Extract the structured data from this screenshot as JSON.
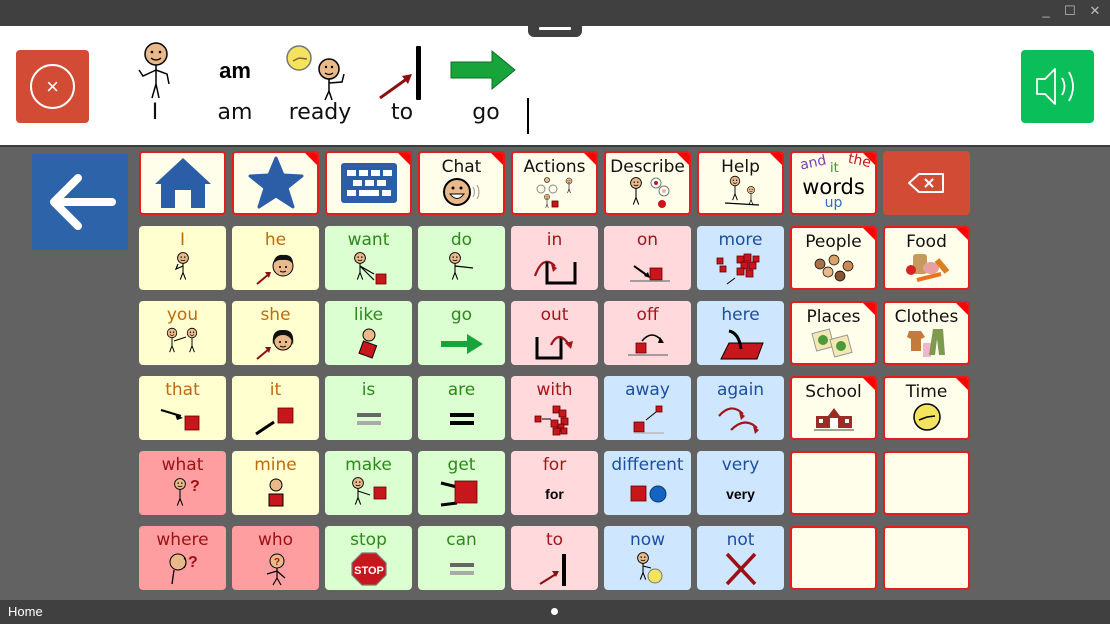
{
  "window": {
    "controls": [
      {
        "name": "minimize",
        "glyph": "_"
      },
      {
        "name": "maximize",
        "glyph": "☐"
      },
      {
        "name": "close",
        "glyph": "✕"
      }
    ]
  },
  "message_bar": {
    "clear_icon": "×",
    "words": [
      {
        "label": "I",
        "symbol": "person-pointing-self"
      },
      {
        "label": "am",
        "symbol": "am",
        "symbol_text": "am"
      },
      {
        "label": "ready",
        "symbol": "person-clock-thumbs-up"
      },
      {
        "label": "to",
        "symbol": "arrow-to-line"
      },
      {
        "label": "go",
        "symbol": "green-right-arrow"
      }
    ]
  },
  "colors": {
    "folder_border": "#e61c1c",
    "folder_fill": "#fffeeb",
    "yellow": "#ffffcf",
    "green": "#dcffd1",
    "pink": "#ffd9dc",
    "blue": "#cfe6ff",
    "red": "#ff9ea0",
    "back_button": "#2d63a8",
    "clear_button": "#d14b35",
    "speak_button": "#0abf5a",
    "icon_blue": "#2b5ea7"
  },
  "grid": {
    "rows": [
      [
        {
          "label": "",
          "type": "folder",
          "icon": "home",
          "corner": false
        },
        {
          "label": "",
          "type": "folder",
          "icon": "star",
          "corner": true
        },
        {
          "label": "",
          "type": "folder",
          "icon": "keyboard",
          "corner": true
        },
        {
          "label": "Chat",
          "type": "folder",
          "icon": "chat-face",
          "corner": true
        },
        {
          "label": "Actions",
          "type": "folder",
          "icon": "actions",
          "corner": true
        },
        {
          "label": "Describe",
          "type": "folder",
          "icon": "describe",
          "corner": true
        },
        {
          "label": "Help",
          "type": "folder",
          "icon": "help",
          "corner": true
        },
        {
          "label": "words",
          "type": "folder",
          "icon": "words",
          "corner": true,
          "extra": {
            "and": "and",
            "it": "it",
            "the": "the",
            "up": "up"
          }
        },
        {
          "label": "",
          "type": "delete",
          "icon": "backspace",
          "corner": false
        }
      ],
      [
        {
          "label": "I",
          "type": "yellow",
          "icon": "person-self"
        },
        {
          "label": "he",
          "type": "yellow",
          "icon": "boy-face"
        },
        {
          "label": "want",
          "type": "green",
          "icon": "want"
        },
        {
          "label": "do",
          "type": "green",
          "icon": "do"
        },
        {
          "label": "in",
          "type": "pink",
          "icon": "in"
        },
        {
          "label": "on",
          "type": "pink",
          "icon": "on"
        },
        {
          "label": "more",
          "type": "blue",
          "icon": "more"
        },
        {
          "label": "People",
          "type": "folder",
          "icon": "people",
          "corner": true
        },
        {
          "label": "Food",
          "type": "folder",
          "icon": "food",
          "corner": true
        }
      ],
      [
        {
          "label": "you",
          "type": "yellow",
          "icon": "you"
        },
        {
          "label": "she",
          "type": "yellow",
          "icon": "girl-face"
        },
        {
          "label": "like",
          "type": "green",
          "icon": "like"
        },
        {
          "label": "go",
          "type": "green",
          "icon": "green-arrow"
        },
        {
          "label": "out",
          "type": "pink",
          "icon": "out"
        },
        {
          "label": "off",
          "type": "pink",
          "icon": "off"
        },
        {
          "label": "here",
          "type": "blue",
          "icon": "here"
        },
        {
          "label": "Places",
          "type": "folder",
          "icon": "maps",
          "corner": true
        },
        {
          "label": "Clothes",
          "type": "folder",
          "icon": "clothes",
          "corner": true
        }
      ],
      [
        {
          "label": "that",
          "type": "yellow",
          "icon": "that"
        },
        {
          "label": "it",
          "type": "yellow",
          "icon": "it"
        },
        {
          "label": "is",
          "type": "green",
          "icon": "equals-grey"
        },
        {
          "label": "are",
          "type": "green",
          "icon": "equals-black"
        },
        {
          "label": "with",
          "type": "pink",
          "icon": "with"
        },
        {
          "label": "away",
          "type": "blue",
          "icon": "away"
        },
        {
          "label": "again",
          "type": "blue",
          "icon": "again"
        },
        {
          "label": "School",
          "type": "folder",
          "icon": "school",
          "corner": true
        },
        {
          "label": "Time",
          "type": "folder",
          "icon": "clock",
          "corner": true
        }
      ],
      [
        {
          "label": "what",
          "type": "red",
          "icon": "what"
        },
        {
          "label": "mine",
          "type": "yellow",
          "icon": "mine"
        },
        {
          "label": "make",
          "type": "green",
          "icon": "make"
        },
        {
          "label": "get",
          "type": "green",
          "icon": "get"
        },
        {
          "label": "for",
          "type": "pink",
          "icon": "text",
          "symbol_text": "for"
        },
        {
          "label": "different",
          "type": "blue",
          "icon": "different"
        },
        {
          "label": "very",
          "type": "blue",
          "icon": "text",
          "symbol_text": "very"
        },
        {
          "label": "",
          "type": "folder",
          "icon": "",
          "corner": false
        },
        {
          "label": "",
          "type": "folder",
          "icon": "",
          "corner": false
        }
      ],
      [
        {
          "label": "where",
          "type": "red",
          "icon": "where"
        },
        {
          "label": "who",
          "type": "red",
          "icon": "who"
        },
        {
          "label": "stop",
          "type": "green",
          "icon": "stop-sign",
          "symbol_text": "STOP"
        },
        {
          "label": "can",
          "type": "green",
          "icon": "equals-grey"
        },
        {
          "label": "to",
          "type": "pink",
          "icon": "arrow-to-line"
        },
        {
          "label": "now",
          "type": "blue",
          "icon": "now"
        },
        {
          "label": "not",
          "type": "blue",
          "icon": "red-x"
        },
        {
          "label": "",
          "type": "folder",
          "icon": "",
          "corner": false
        },
        {
          "label": "",
          "type": "folder",
          "icon": "",
          "corner": false
        }
      ]
    ]
  },
  "status_bar": {
    "page_name": "Home",
    "page_count": 1,
    "current_page": 1
  }
}
